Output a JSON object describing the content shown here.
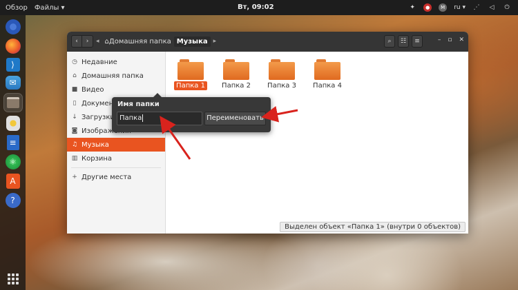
{
  "topbar": {
    "activities": "Обзор",
    "app_menu": "Файлы ▾",
    "clock": "Вт, 09:02",
    "lang": "ru ▾",
    "accessibility_icon": "accessibility-icon",
    "network_icon": "network-icon",
    "volume_icon": "volume-icon",
    "power_icon": "power-icon"
  },
  "dock": {
    "items": [
      "chromium-icon",
      "firefox-icon",
      "vscode-icon",
      "mail-icon",
      "files-icon",
      "rhythmbox-icon",
      "writer-icon",
      "atom-icon",
      "software-icon",
      "help-icon",
      "apps-grid-icon"
    ]
  },
  "window": {
    "path": [
      "Домашняя папка",
      "Музыка"
    ],
    "home_crumb_icon": "home-icon",
    "sidebar": [
      {
        "label": "Недавние",
        "icon": "clock-icon"
      },
      {
        "label": "Домашняя папка",
        "icon": "home-icon"
      },
      {
        "label": "Видео",
        "icon": "video-icon"
      },
      {
        "label": "Документы",
        "icon": "document-icon"
      },
      {
        "label": "Загрузки",
        "icon": "download-icon"
      },
      {
        "label": "Изображения",
        "icon": "image-icon"
      },
      {
        "label": "Музыка",
        "icon": "music-icon",
        "selected": true
      },
      {
        "label": "Корзина",
        "icon": "trash-icon"
      },
      {
        "label": "Другие места",
        "icon": "plus-icon"
      }
    ],
    "folders": [
      {
        "label": "Папка 1",
        "selected": true
      },
      {
        "label": "Папка 2"
      },
      {
        "label": "Папка 3"
      },
      {
        "label": "Папка 4"
      }
    ],
    "status": "Выделен объект «Папка 1» (внутри 0 объектов)"
  },
  "rename_popover": {
    "title": "Имя папки",
    "input_value": "Папка",
    "button_label": "Переименовать"
  },
  "colors": {
    "accent": "#e95420",
    "headerbar": "#353535",
    "annotation_arrow": "#d9231d"
  }
}
